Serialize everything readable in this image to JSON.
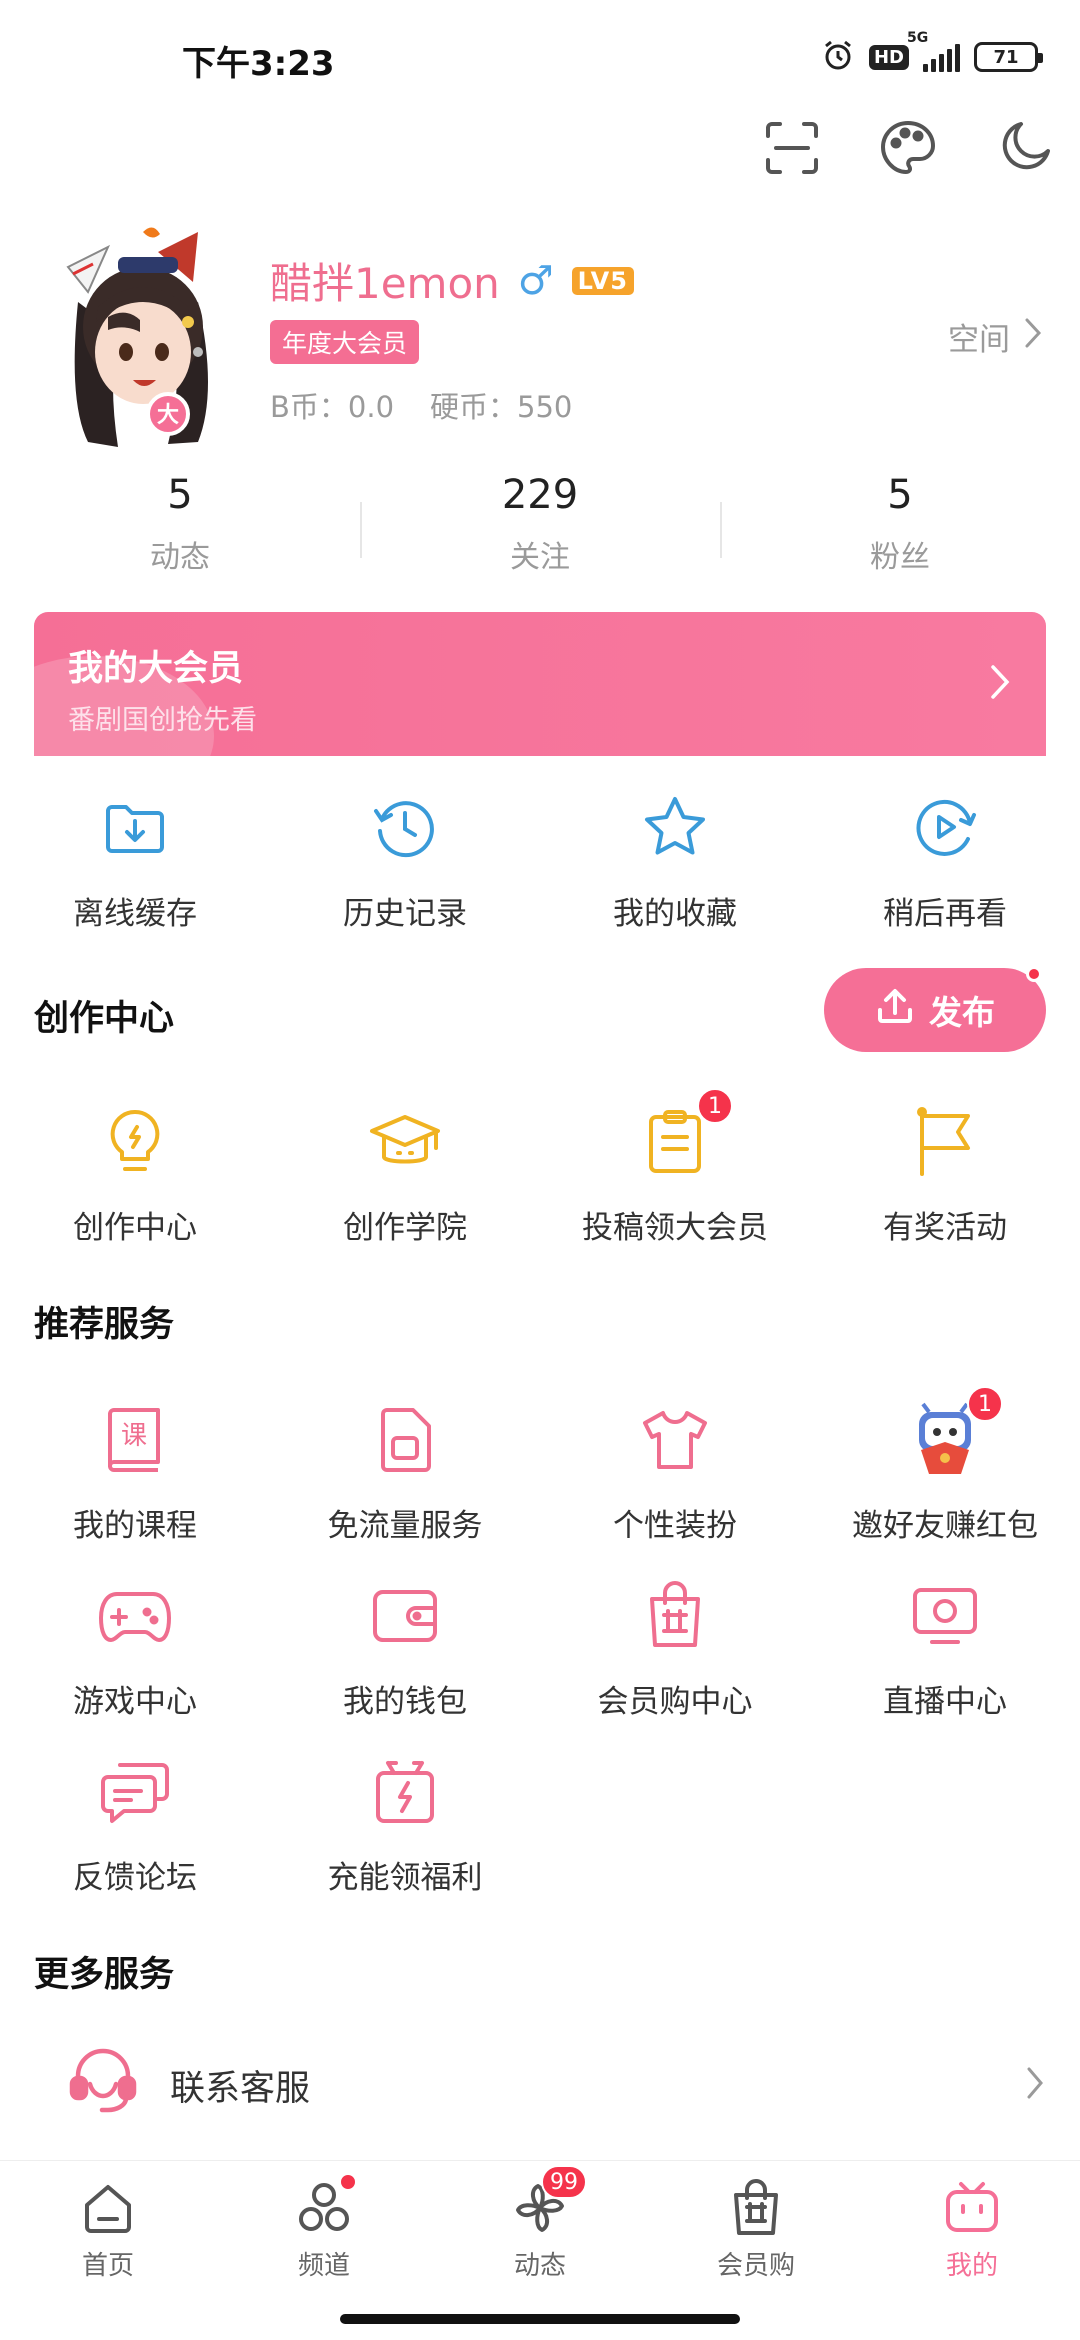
{
  "status_bar": {
    "time": "下午3:23",
    "hd": "HD",
    "network": "5G",
    "battery": "71"
  },
  "top_tools": [
    {
      "icon": "scan-icon"
    },
    {
      "icon": "palette-icon"
    },
    {
      "icon": "moon-icon"
    }
  ],
  "profile": {
    "name": "醋拌1emon",
    "gender_symbol": "♂",
    "level": "LV5",
    "vip_tag": "年度大会员",
    "bcoin": "B币：0.0",
    "coins": "硬币：550",
    "space_label": "空间"
  },
  "stats": [
    {
      "value": "5",
      "label": "动态"
    },
    {
      "value": "229",
      "label": "关注"
    },
    {
      "value": "5",
      "label": "粉丝"
    }
  ],
  "vip_banner": {
    "title": "我的大会员",
    "subtitle": "番剧国创抢先看"
  },
  "quick_actions": [
    {
      "label": "离线缓存",
      "icon": "download-folder-icon"
    },
    {
      "label": "历史记录",
      "icon": "history-clock-icon"
    },
    {
      "label": "我的收藏",
      "icon": "star-icon"
    },
    {
      "label": "稍后再看",
      "icon": "play-later-icon"
    }
  ],
  "creation": {
    "title": "创作中心",
    "publish_label": "发布",
    "items": [
      {
        "label": "创作中心",
        "icon": "lightbulb-icon",
        "badge": ""
      },
      {
        "label": "创作学院",
        "icon": "graduation-cap-icon",
        "badge": ""
      },
      {
        "label": "投稿领大会员",
        "icon": "clipboard-icon",
        "badge": "1"
      },
      {
        "label": "有奖活动",
        "icon": "flag-icon",
        "badge": ""
      }
    ]
  },
  "recommended": {
    "title": "推荐服务",
    "items": [
      {
        "label": "我的课程",
        "icon": "course-book-icon",
        "badge": "",
        "glyph": "课"
      },
      {
        "label": "免流量服务",
        "icon": "sim-card-icon",
        "badge": ""
      },
      {
        "label": "个性装扮",
        "icon": "tshirt-icon",
        "badge": ""
      },
      {
        "label": "邀好友赚红包",
        "icon": "mascot-red-packet-icon",
        "badge": "1"
      },
      {
        "label": "游戏中心",
        "icon": "gamepad-icon",
        "badge": ""
      },
      {
        "label": "我的钱包",
        "icon": "wallet-icon",
        "badge": ""
      },
      {
        "label": "会员购中心",
        "icon": "shopping-bag-icon",
        "badge": ""
      },
      {
        "label": "直播中心",
        "icon": "live-tv-icon",
        "badge": ""
      },
      {
        "label": "反馈论坛",
        "icon": "feedback-chat-icon",
        "badge": ""
      },
      {
        "label": "充能领福利",
        "icon": "gift-bolt-icon",
        "badge": ""
      }
    ]
  },
  "more_services": {
    "title": "更多服务",
    "contact_label": "联系客服"
  },
  "bottom_nav": [
    {
      "label": "首页",
      "icon": "home-icon",
      "badge": "",
      "dot": false,
      "active": false
    },
    {
      "label": "频道",
      "icon": "channel-icon",
      "badge": "",
      "dot": true,
      "active": false
    },
    {
      "label": "动态",
      "icon": "pinwheel-icon",
      "badge": "99",
      "dot": false,
      "active": false
    },
    {
      "label": "会员购",
      "icon": "shopping-bag-icon",
      "badge": "",
      "dot": false,
      "active": false
    },
    {
      "label": "我的",
      "icon": "tv-mascot-icon",
      "badge": "",
      "dot": false,
      "active": true
    }
  ],
  "colors": {
    "accent": "#f56f96",
    "vip_pink": "#f46e93",
    "blue_icon": "#3a9bd9",
    "yellow_icon": "#f0b322",
    "pink_icon": "#ef6e8f",
    "badge_red": "#f5334b"
  }
}
